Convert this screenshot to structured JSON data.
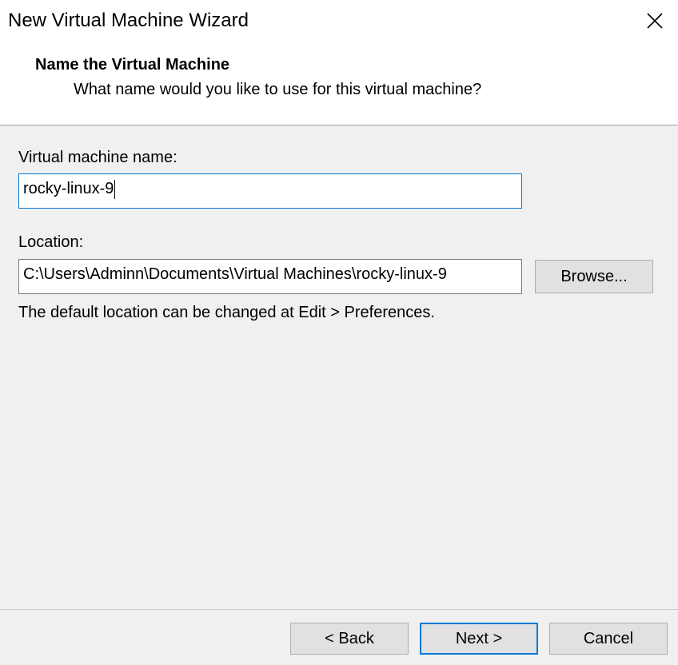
{
  "window": {
    "title": "New Virtual Machine Wizard",
    "close_icon": "close-icon"
  },
  "header": {
    "title": "Name the Virtual Machine",
    "subtitle": "What name would you like to use for this virtual machine?"
  },
  "form": {
    "vm_name_label": "Virtual machine name:",
    "vm_name_value": "rocky-linux-9",
    "location_label": "Location:",
    "location_value": "C:\\Users\\Adminn\\Documents\\Virtual Machines\\rocky-linux-9",
    "browse_label": "Browse...",
    "hint": "The default location can be changed at Edit > Preferences."
  },
  "footer": {
    "back_label": "< Back",
    "next_label": "Next >",
    "cancel_label": "Cancel"
  },
  "colors": {
    "accent": "#0078d7",
    "dialog_background": "#f0f0f0",
    "button_background": "#e1e1e1"
  }
}
